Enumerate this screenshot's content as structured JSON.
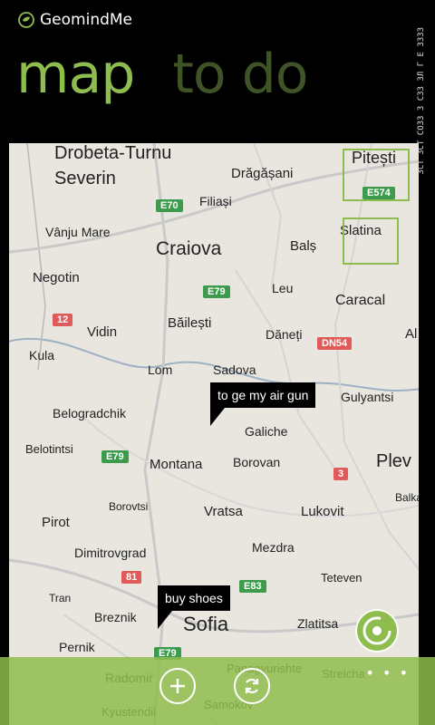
{
  "app": {
    "name": "GeomindMe"
  },
  "pivot": {
    "items": [
      "map",
      "to do"
    ]
  },
  "side_text": "ЗСТ ЗСТ СОЗЗ З СЗЗ ЗЛ Г Е ЗЗЗЗ",
  "map": {
    "cities": [
      {
        "name": "Drobeta-Turnu",
        "size": 20
      },
      {
        "name": "Severin",
        "size": 20
      },
      {
        "name": "Drăgășani",
        "size": 15
      },
      {
        "name": "Pitești",
        "size": 18
      },
      {
        "name": "Filiași",
        "size": 14
      },
      {
        "name": "Vânju Mare",
        "size": 14
      },
      {
        "name": "Craiova",
        "size": 21
      },
      {
        "name": "Balș",
        "size": 15
      },
      {
        "name": "Slatina",
        "size": 15
      },
      {
        "name": "Negotin",
        "size": 15
      },
      {
        "name": "Leu",
        "size": 14
      },
      {
        "name": "Caracal",
        "size": 16
      },
      {
        "name": "Vidin",
        "size": 15
      },
      {
        "name": "Băilești",
        "size": 15
      },
      {
        "name": "Dăneți",
        "size": 14
      },
      {
        "name": "Al",
        "size": 15
      },
      {
        "name": "Kula",
        "size": 14
      },
      {
        "name": "Lom",
        "size": 14
      },
      {
        "name": "Sadova",
        "size": 14
      },
      {
        "name": "Belogradchik",
        "size": 14
      },
      {
        "name": "Galiche",
        "size": 14
      },
      {
        "name": "Gulyantsi",
        "size": 14
      },
      {
        "name": "Belotintsi",
        "size": 13
      },
      {
        "name": "Montana",
        "size": 15
      },
      {
        "name": "Borovan",
        "size": 14
      },
      {
        "name": "Plev",
        "size": 20
      },
      {
        "name": "Borovtsi",
        "size": 12
      },
      {
        "name": "Vratsa",
        "size": 15
      },
      {
        "name": "Lukovit",
        "size": 15
      },
      {
        "name": "Pirot",
        "size": 15
      },
      {
        "name": "Mezdra",
        "size": 14
      },
      {
        "name": "Dimitrovgrad",
        "size": 14
      },
      {
        "name": "Teteven",
        "size": 13
      },
      {
        "name": "Tran",
        "size": 12
      },
      {
        "name": "Breznik",
        "size": 14
      },
      {
        "name": "Sofia",
        "size": 22
      },
      {
        "name": "Zlatitsa",
        "size": 14
      },
      {
        "name": "Pernik",
        "size": 14
      },
      {
        "name": "Radomir",
        "size": 14
      },
      {
        "name": "Panagyurishte",
        "size": 13
      },
      {
        "name": "Strelcha",
        "size": 13
      },
      {
        "name": "Samokov",
        "size": 13
      },
      {
        "name": "Kyustendil",
        "size": 13
      },
      {
        "name": "Balka",
        "size": 12
      }
    ],
    "shields": [
      {
        "label": "E70",
        "kind": "e"
      },
      {
        "label": "E574",
        "kind": "e"
      },
      {
        "label": "E79",
        "kind": "e"
      },
      {
        "label": "12",
        "kind": "r"
      },
      {
        "label": "DN54",
        "kind": "r"
      },
      {
        "label": "E79",
        "kind": "e"
      },
      {
        "label": "3",
        "kind": "r"
      },
      {
        "label": "81",
        "kind": "r"
      },
      {
        "label": "E83",
        "kind": "e"
      },
      {
        "label": "E79",
        "kind": "e"
      }
    ],
    "pins": [
      {
        "text": "to ge my air gun"
      },
      {
        "text": "buy shoes"
      }
    ]
  },
  "appbar": {
    "buttons": [
      {
        "name": "add-button",
        "icon": "plus-icon"
      },
      {
        "name": "refresh-button",
        "icon": "refresh-icon"
      }
    ],
    "more": "• • •"
  },
  "colors": {
    "accent": "#8fbc4e",
    "road_green": "#3d9b4e",
    "road_red": "#e05a5a"
  }
}
